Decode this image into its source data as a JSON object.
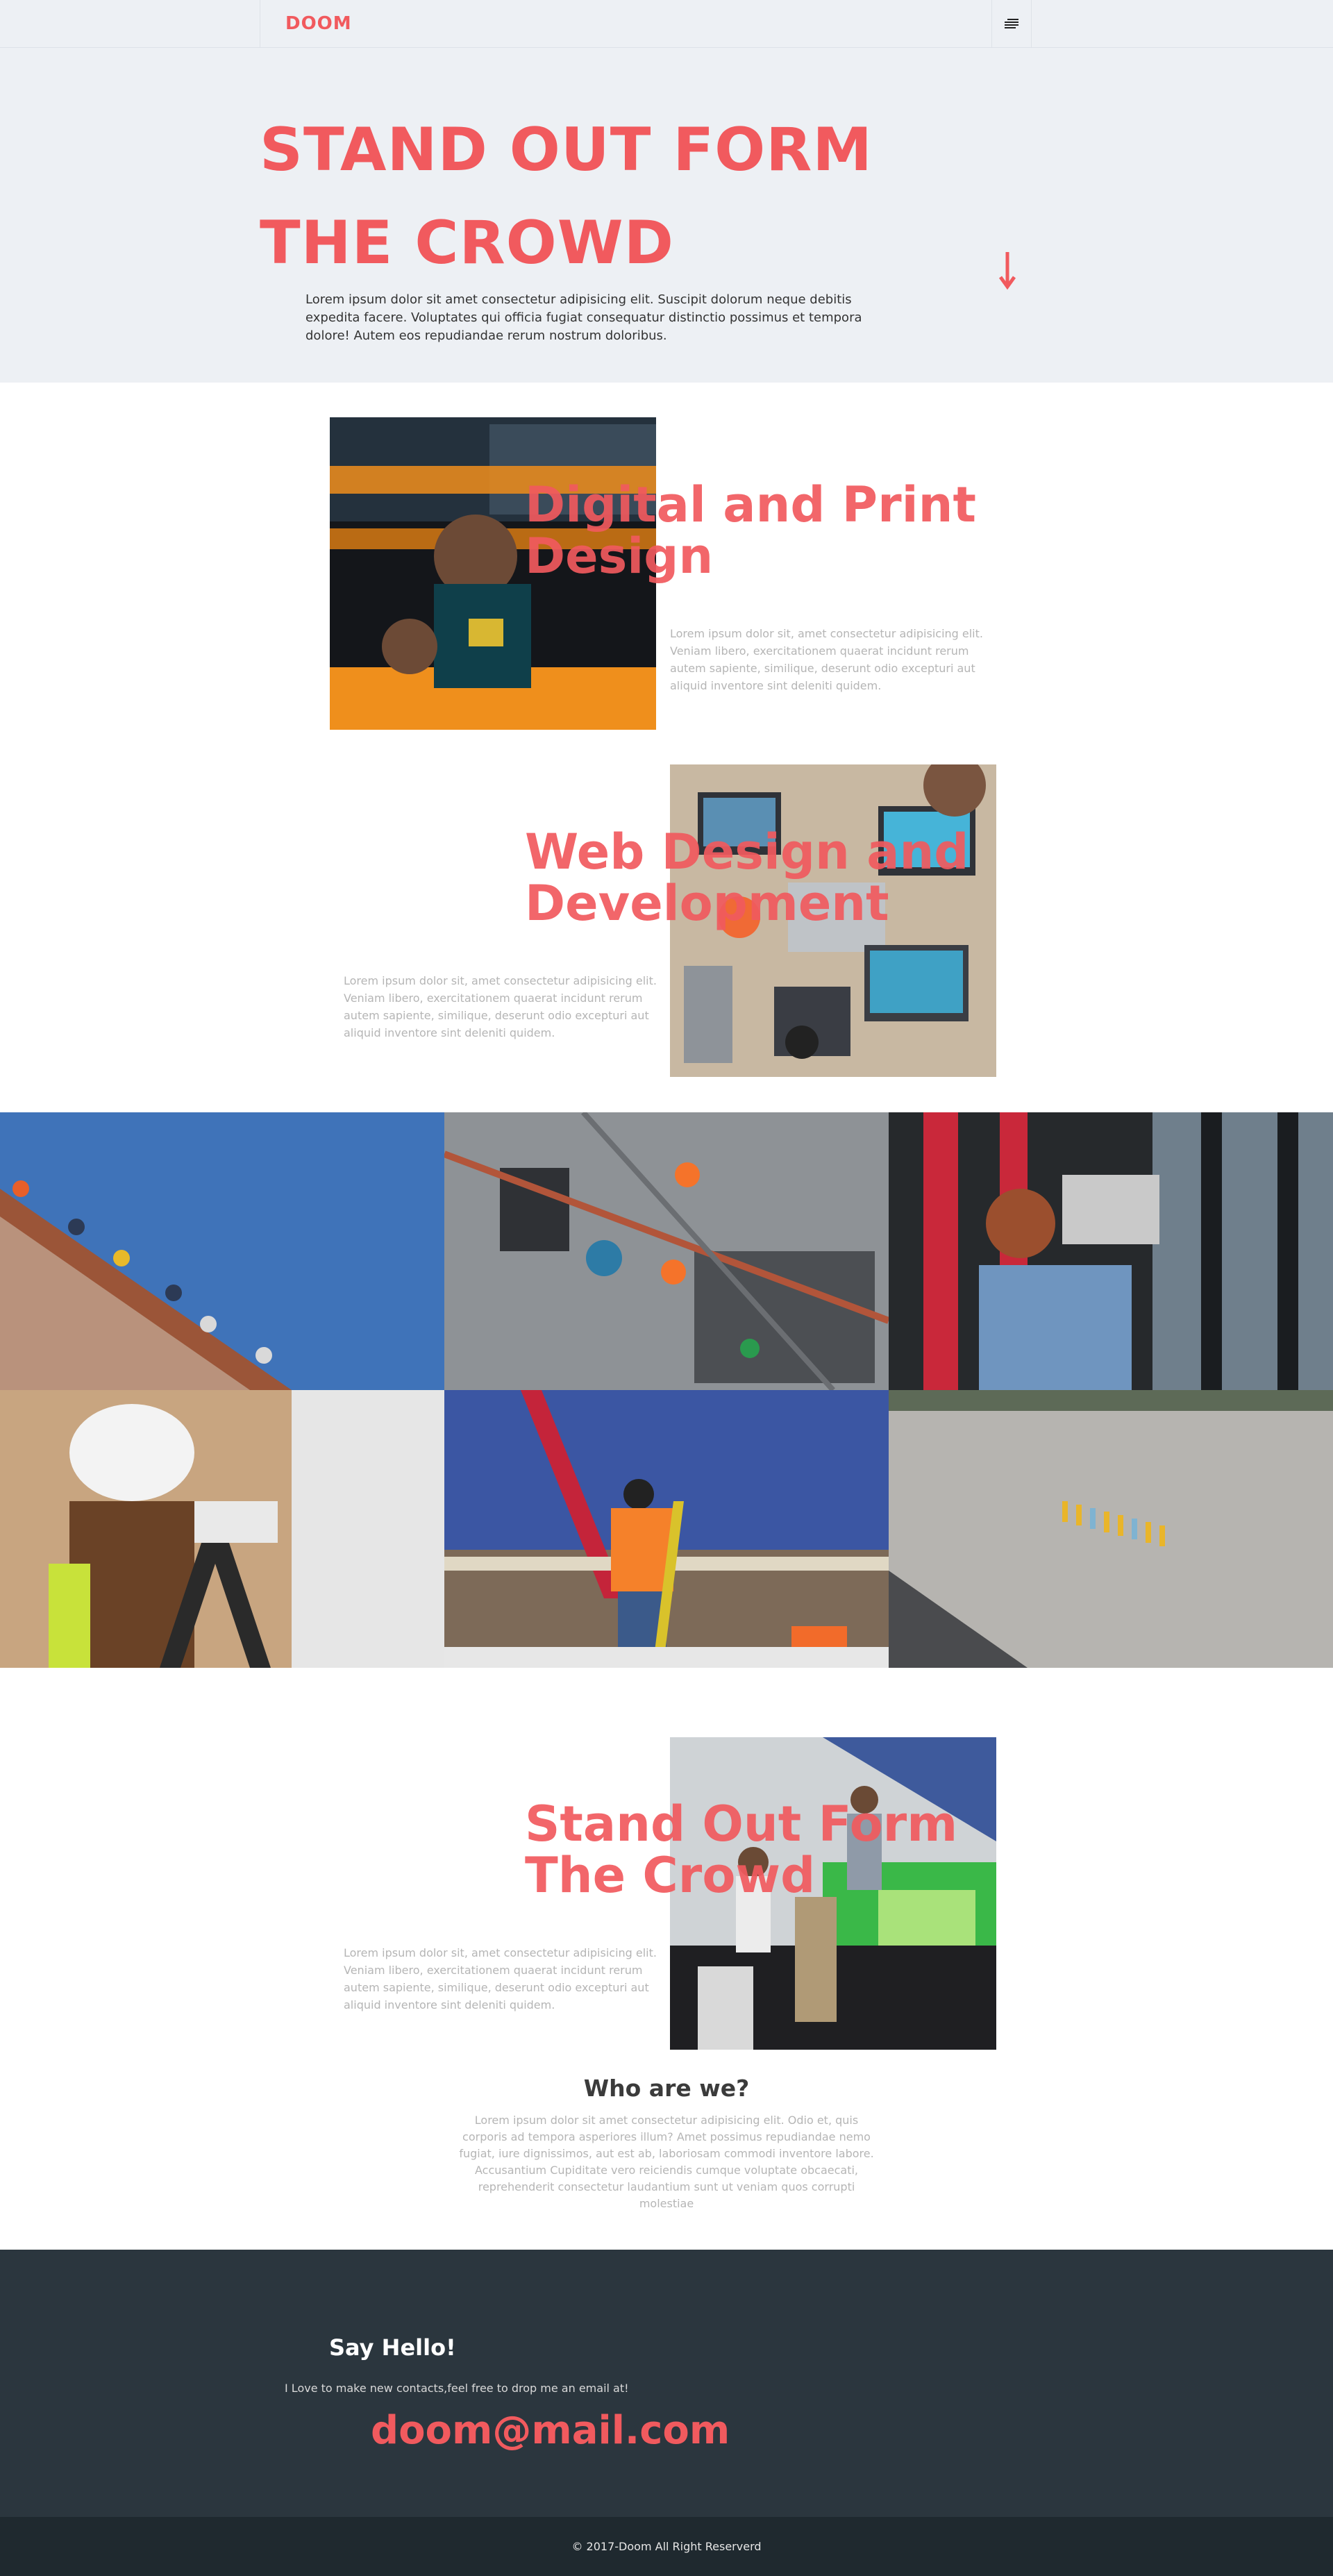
{
  "nav": {
    "brand": "DOOM",
    "menu_icon": "hamburger-menu-icon"
  },
  "hero": {
    "title": "STAND OUT FORM THE CROWD",
    "text": "Lorem ipsum dolor sit amet consectetur adipisicing elit. Suscipit dolorum neque debitis expedita facere. Voluptates qui officia fugiat consequatur distinctio possimus et tempora dolore! Autem eos repudiandae rerum nostrum doloribus.",
    "arrow_icon": "arrow-down-icon"
  },
  "services": [
    {
      "title": "Digital and Print Design",
      "text": "Lorem ipsum dolor sit, amet consectetur adipisicing elit. Veniam libero, exercitationem quaerat incidunt rerum autem sapiente, similique, deserunt odio excepturi aut aliquid inventore sint deleniti quidem."
    },
    {
      "title": "Web Design and Development",
      "text": "Lorem ipsum dolor sit, amet consectetur adipisicing elit. Veniam libero, exercitationem quaerat incidunt rerum autem sapiente, similique, deserunt odio excepturi aut aliquid inventore sint deleniti quidem."
    },
    {
      "title": "Stand Out Form The Crowd",
      "text": "Lorem ipsum dolor sit, amet consectetur adipisicing elit. Veniam libero, exercitationem quaerat incidunt rerum autem sapiente, similique, deserunt odio excepturi aut aliquid inventore sint deleniti quidem."
    }
  ],
  "who": {
    "title": "Who are we?",
    "text": "Lorem ipsum dolor sit amet consectetur adipisicing elit. Odio et, quis corporis ad tempora asperiores illum? Amet possimus repudiandae nemo fugiat, iure dignissimos, aut est ab, laboriosam commodi inventore labore. Accusantium Cupiditate vero reiciendis cumque voluptate obcaecati, reprehenderit consectetur laudantium sunt ut veniam quos corrupti molestiae"
  },
  "contact": {
    "title": "Say Hello!",
    "lead": "I Love to make new contacts,feel free to drop me an email at!",
    "email": "doom@mail.com"
  },
  "footer": {
    "copyright": "© 2017-Doom All Right Reserverd"
  },
  "colors": {
    "accent": "#f15a5e",
    "hero_bg": "#edf0f4",
    "dark": "#2b363e",
    "darker": "#1f292f"
  }
}
